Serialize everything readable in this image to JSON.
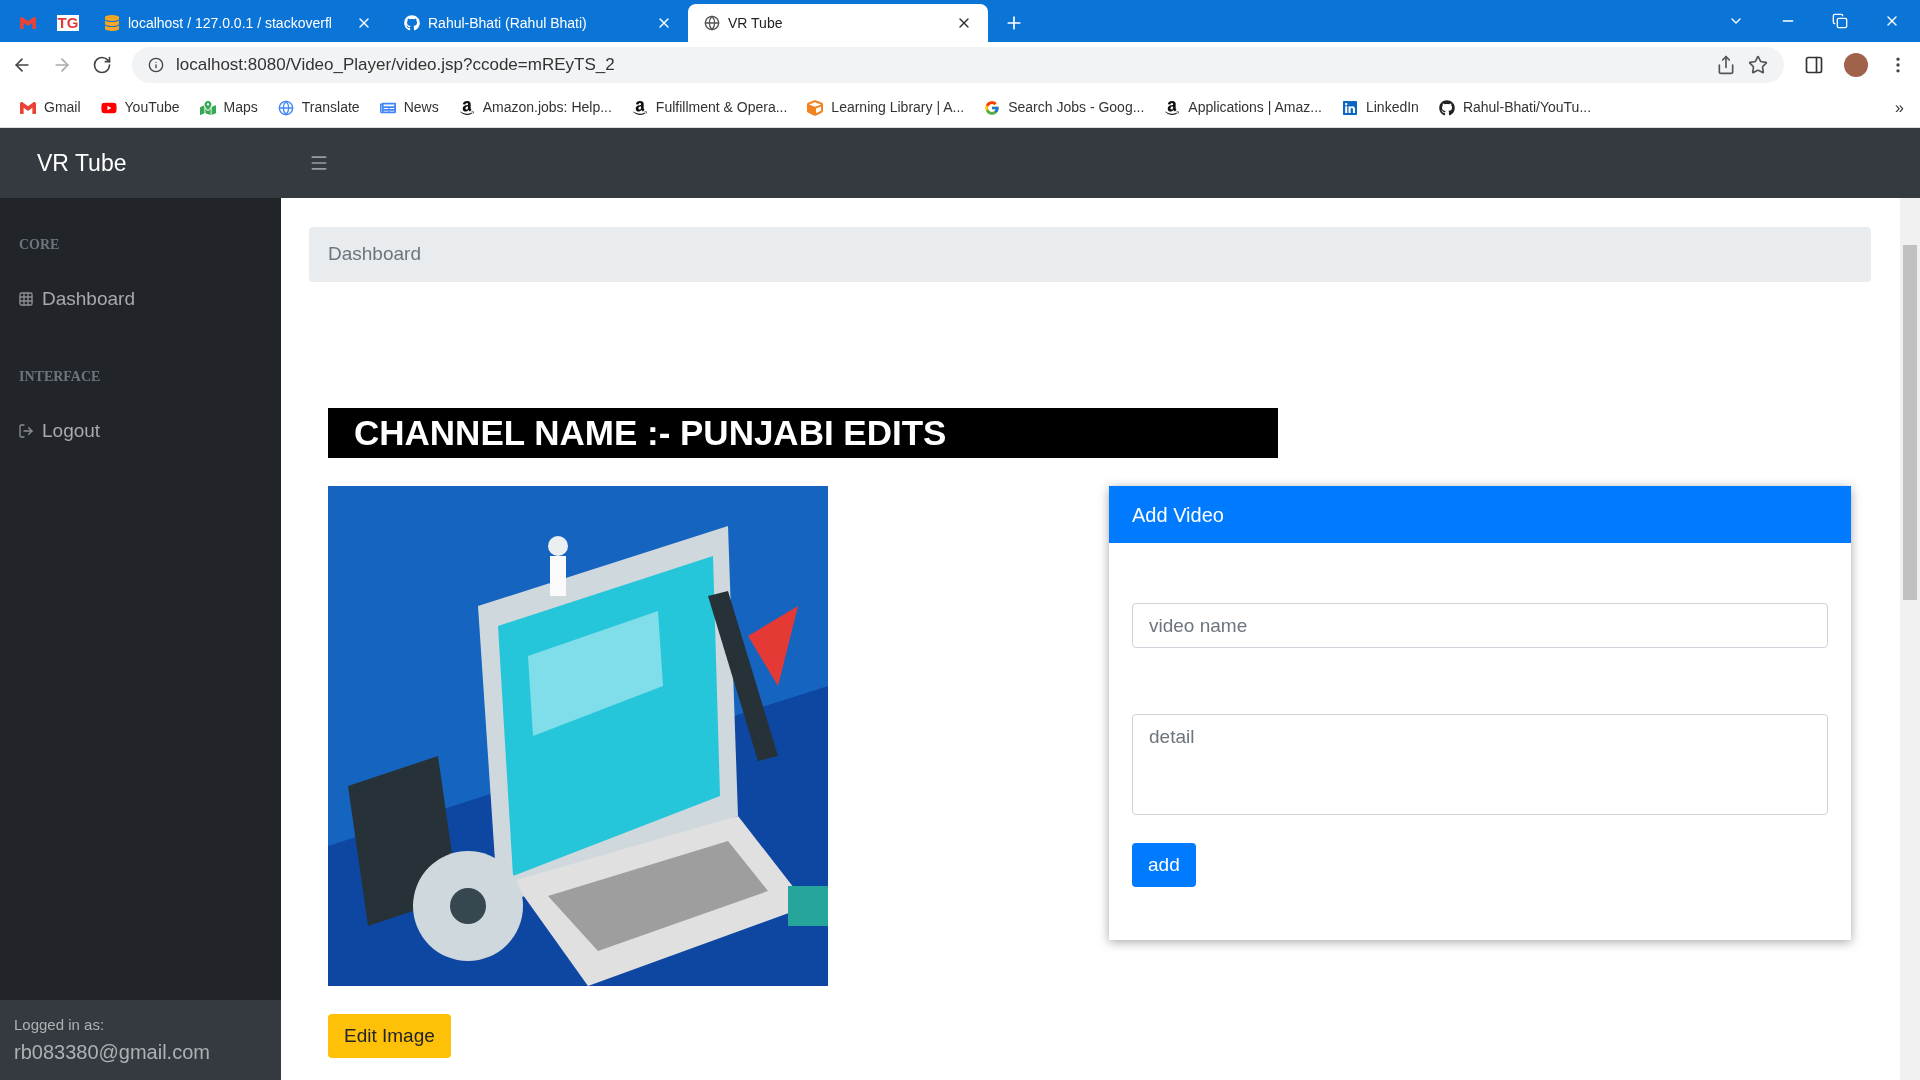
{
  "browser": {
    "tabs": [
      {
        "kind": "mail",
        "selected": false
      },
      {
        "kind": "text-logo",
        "title": "TG",
        "selected": false
      },
      {
        "kind": "db",
        "title": "localhost / 127.0.0.1 / stackoverfl",
        "selected": false
      },
      {
        "kind": "github",
        "title": "Rahul-Bhati (Rahul Bhati)",
        "selected": false
      },
      {
        "kind": "globe",
        "title": "VR Tube",
        "selected": true
      }
    ],
    "url": "localhost:8080/Video_Player/video.jsp?ccode=mREyTS_2",
    "bookmarks": [
      {
        "kind": "gmail",
        "label": "Gmail"
      },
      {
        "kind": "youtube",
        "label": "YouTube"
      },
      {
        "kind": "maps",
        "label": "Maps"
      },
      {
        "kind": "translate",
        "label": "Translate"
      },
      {
        "kind": "news",
        "label": "News"
      },
      {
        "kind": "amazon",
        "label": "Amazon.jobs: Help..."
      },
      {
        "kind": "amazon",
        "label": "Fulfillment & Opera..."
      },
      {
        "kind": "box",
        "label": "Learning Library | A..."
      },
      {
        "kind": "google",
        "label": "Search Jobs - Goog..."
      },
      {
        "kind": "amazon",
        "label": "Applications | Amaz..."
      },
      {
        "kind": "linkedin",
        "label": "LinkedIn"
      },
      {
        "kind": "github",
        "label": "Rahul-Bhati/YouTu..."
      }
    ],
    "more_bookmarks": "»"
  },
  "navbar": {
    "brand": "VR Tube"
  },
  "sidebar": {
    "sections": [
      {
        "heading": "CORE",
        "items": [
          {
            "kind": "grid",
            "label": "Dashboard"
          }
        ]
      },
      {
        "heading": "INTERFACE",
        "items": [
          {
            "kind": "logout",
            "label": "Logout"
          }
        ]
      }
    ],
    "footer": {
      "caption": "Logged in as:",
      "user": "rb083380@gmail.com"
    }
  },
  "page": {
    "breadcrumb": "Dashboard",
    "channel_banner": "CHANNEL NAME :- PUNJABI EDITS",
    "edit_button": "Edit Image",
    "add_video": {
      "title": "Add Video",
      "name_placeholder": "video name",
      "detail_placeholder": "detail",
      "button": "add"
    }
  }
}
